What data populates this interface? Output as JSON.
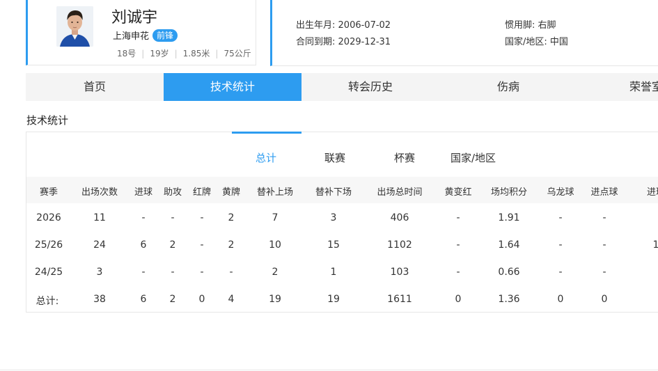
{
  "player": {
    "name": "刘诚宇",
    "team": "上海申花",
    "position": "前锋",
    "number": "18号",
    "age": "19岁",
    "height": "1.85米",
    "weight": "75公斤"
  },
  "info": {
    "birth_label": "出生年月:",
    "birth_value": "2006-07-02",
    "contract_label": "合同到期:",
    "contract_value": "2029-12-31",
    "foot_label": "惯用脚:",
    "foot_value": "右脚",
    "nation_label": "国家/地区:",
    "nation_value": "中国"
  },
  "tabs": [
    "首页",
    "技术统计",
    "转会历史",
    "伤病",
    "荣誉室"
  ],
  "active_tab": "技术统计",
  "section_title": "技术统计",
  "sub_tabs": [
    "总计",
    "联赛",
    "杯赛",
    "国家/地区"
  ],
  "active_sub_tab": "总计",
  "table": {
    "headers": [
      "赛季",
      "出场次数",
      "进球",
      "助攻",
      "红牌",
      "黄牌",
      "替补上场",
      "替补下场",
      "出场总时间",
      "黄变红",
      "场均积分",
      "乌龙球",
      "进点球",
      "进球"
    ],
    "rows": [
      [
        "2026",
        "11",
        "-",
        "-",
        "-",
        "2",
        "7",
        "3",
        "406",
        "-",
        "1.91",
        "-",
        "-",
        ""
      ],
      [
        "25/26",
        "24",
        "6",
        "2",
        "-",
        "2",
        "10",
        "15",
        "1102",
        "-",
        "1.64",
        "-",
        "-",
        "1"
      ],
      [
        "24/25",
        "3",
        "-",
        "-",
        "-",
        "-",
        "2",
        "1",
        "103",
        "-",
        "0.66",
        "-",
        "-",
        ""
      ],
      [
        "总计:",
        "38",
        "6",
        "2",
        "0",
        "4",
        "19",
        "19",
        "1611",
        "0",
        "1.36",
        "0",
        "0",
        ""
      ]
    ]
  },
  "colors": {
    "accent": "#2d9cf0"
  }
}
